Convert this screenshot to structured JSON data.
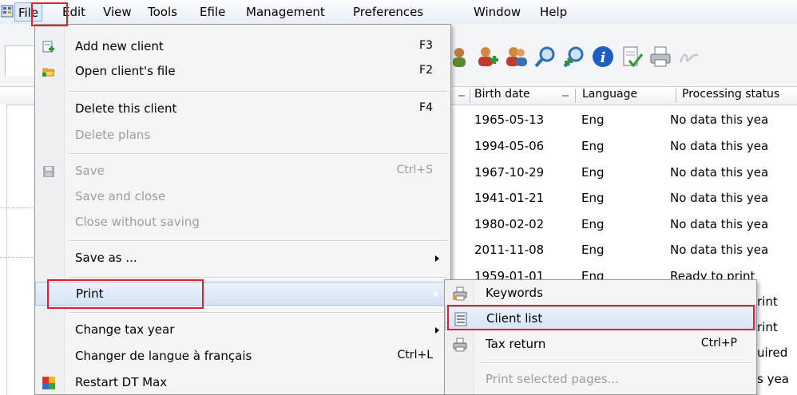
{
  "menubar": {
    "items": [
      "File",
      "Edit",
      "View",
      "Tools",
      "Efile",
      "Management",
      "Preferences",
      "Window",
      "Help"
    ]
  },
  "grid": {
    "headers": {
      "birth_date": "Birth date",
      "language": "Language",
      "status": "Processing status"
    },
    "rows": [
      {
        "birth": "1965-05-13",
        "lang": "Eng",
        "status": "No data this yea"
      },
      {
        "birth": "1994-05-06",
        "lang": "Eng",
        "status": "No data this yea"
      },
      {
        "birth": "1967-10-29",
        "lang": "Eng",
        "status": "No data this yea"
      },
      {
        "birth": "1941-01-21",
        "lang": "Eng",
        "status": "No data this yea"
      },
      {
        "birth": "1980-02-02",
        "lang": "Eng",
        "status": "No data this yea"
      },
      {
        "birth": "2011-11-08",
        "lang": "Eng",
        "status": "No data this yea"
      },
      {
        "birth": "1959-01-01",
        "lang": "Eng",
        "status": "Ready to print"
      }
    ],
    "partial_status": [
      "rint",
      "rint",
      "uired",
      "s yea"
    ]
  },
  "file_menu": {
    "add_new_client": {
      "label": "Add new client",
      "shortcut": "F3"
    },
    "open_file": {
      "label": "Open client's file",
      "shortcut": "F2"
    },
    "delete_client": {
      "label": "Delete this client",
      "shortcut": "F4"
    },
    "delete_plans": {
      "label": "Delete plans"
    },
    "save": {
      "label": "Save",
      "shortcut": "Ctrl+S"
    },
    "save_close": {
      "label": "Save and close"
    },
    "close_nosave": {
      "label": "Close without saving"
    },
    "save_as": {
      "label": "Save as ..."
    },
    "print": {
      "label": "Print"
    },
    "change_year": {
      "label": "Change tax year"
    },
    "change_lang": {
      "label": "Changer de langue à français",
      "shortcut": "Ctrl+L"
    },
    "restart": {
      "label": "Restart DT Max"
    }
  },
  "print_menu": {
    "keywords": {
      "label": "Keywords"
    },
    "client_list": {
      "label": "Client list"
    },
    "tax_return": {
      "label": "Tax return",
      "shortcut": "Ctrl+P"
    },
    "print_selected": {
      "label": "Print selected pages..."
    }
  }
}
